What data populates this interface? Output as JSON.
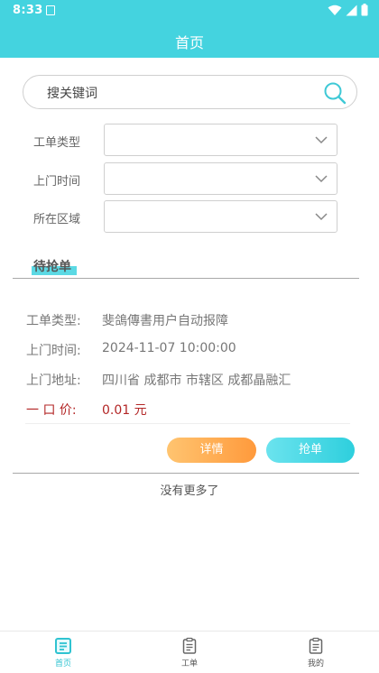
{
  "status_bar": {
    "time": "8:33"
  },
  "header": {
    "title": "首页"
  },
  "search": {
    "placeholder": "搜关键词"
  },
  "filters": [
    {
      "label": "工单类型",
      "value": ""
    },
    {
      "label": "上门时间",
      "value": ""
    },
    {
      "label": "所在区域",
      "value": ""
    }
  ],
  "tabs": [
    {
      "label": "待抢单",
      "active": true
    }
  ],
  "order": {
    "type_label": "工单类型:",
    "type_value": "斐鴿傳書用户自动报障",
    "time_label": "上门时间:",
    "time_value": "2024-11-07 10:00:00",
    "address_label": "上门地址:",
    "address_value": "四川省 成都市 市辖区 成都晶融汇",
    "price_label": "一 口 价:",
    "price_value": "0.01 元",
    "detail_button": "详情",
    "grab_button": "抢单"
  },
  "list_footer": "没有更多了",
  "bottom_nav": [
    {
      "label": "首页",
      "icon": "home-doc-icon",
      "active": true
    },
    {
      "label": "工单",
      "icon": "workorder-icon",
      "active": false
    },
    {
      "label": "我的",
      "icon": "profile-doc-icon",
      "active": false
    }
  ],
  "colors": {
    "accent": "#44d3df",
    "price": "#b32626",
    "detail_button": "#ff9a3c",
    "grab_button": "#2ecfdd"
  }
}
